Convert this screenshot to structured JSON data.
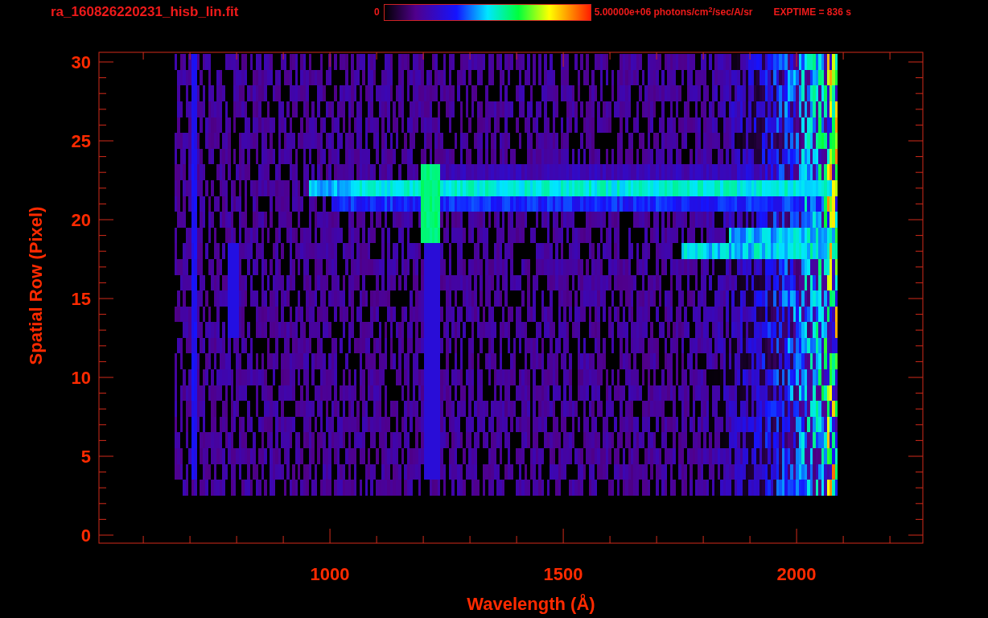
{
  "title": "ra_160826220231_hisb_lin.fit",
  "colorbar": {
    "min_label": "0",
    "max_label": "5.00000e+06 photons/cm$^{2}$/sec/A/sr"
  },
  "exposure": "EXPTIME = 836 s",
  "x_axis": {
    "label": "Wavelength (Å)",
    "ticks": [
      "1000",
      "1500",
      "2000"
    ]
  },
  "y_axis": {
    "label": "Spatial Row (Pixel)",
    "ticks": [
      "30",
      "25",
      "20",
      "15",
      "10",
      "5",
      "0"
    ]
  }
}
